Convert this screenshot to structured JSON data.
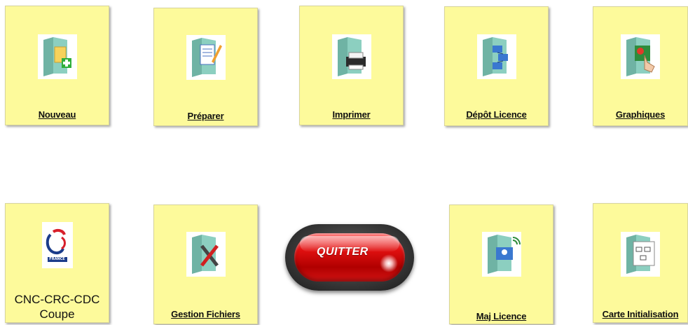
{
  "tiles_row1": [
    {
      "label": "Nouveau",
      "icon": "folder-new-icon"
    },
    {
      "label": "Préparer",
      "icon": "folder-edit-icon"
    },
    {
      "label": "Imprimer",
      "icon": "folder-printer-icon"
    },
    {
      "label": "Dépôt Licence",
      "icon": "folder-network-icon"
    },
    {
      "label": "Graphiques",
      "icon": "folder-graphics-icon"
    }
  ],
  "tiles_row2": [
    {
      "label_line1": "CNC-CRC-CDC",
      "label_line2": "Coupe",
      "icon": "france-rooster-logo-icon",
      "logo_text": "FRANCE"
    },
    {
      "label": "Gestion Fichiers",
      "icon": "folder-tools-icon"
    },
    {
      "label": "Maj Licence",
      "icon": "folder-update-icon"
    },
    {
      "label": "Carte Initialisation",
      "icon": "init-card-icon"
    }
  ],
  "quit": {
    "label": "QUITTER"
  },
  "colors": {
    "tile_bg": "#fdfa9b",
    "quit_red": "#e01010"
  }
}
